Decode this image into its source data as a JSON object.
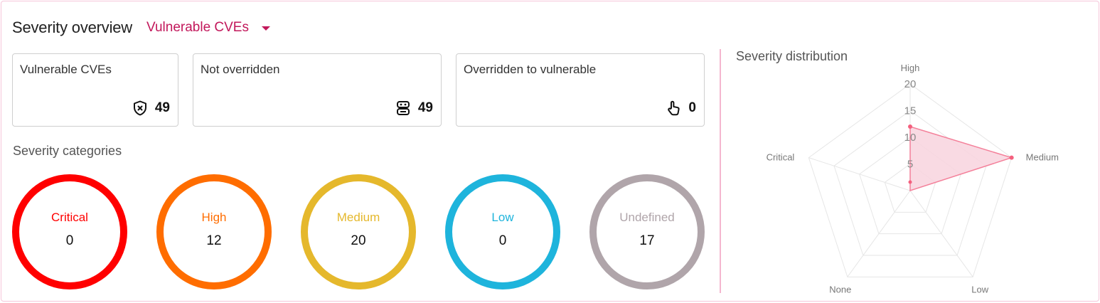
{
  "header": {
    "title": "Severity overview",
    "dropdown_value": "Vulnerable CVEs"
  },
  "cards": [
    {
      "title": "Vulnerable CVEs",
      "value": "49",
      "icon": "shield-x-icon"
    },
    {
      "title": "Not overridden",
      "value": "49",
      "icon": "robot-icon"
    },
    {
      "title": "Overridden to vulnerable",
      "value": "0",
      "icon": "hand-pointer-icon"
    }
  ],
  "categories": {
    "title": "Severity categories",
    "items": [
      {
        "label": "Critical",
        "value": "0",
        "color": "#ff0000"
      },
      {
        "label": "High",
        "value": "12",
        "color": "#ff6d00"
      },
      {
        "label": "Medium",
        "value": "20",
        "color": "#e5b82c"
      },
      {
        "label": "Low",
        "value": "0",
        "color": "#1eb4dc"
      },
      {
        "label": "Undefined",
        "value": "17",
        "color": "#b0a5aa"
      }
    ]
  },
  "distribution": {
    "title": "Severity distribution"
  },
  "chart_data": {
    "type": "radar",
    "axes": [
      "High",
      "Medium",
      "Low",
      "None",
      "Critical"
    ],
    "values": [
      12,
      20,
      0,
      0,
      0
    ],
    "ticks": [
      "5",
      "10",
      "15",
      "20"
    ],
    "rmax": 20,
    "fill_color": "#f8d3de",
    "line_color": "#f4809a",
    "grid_color": "#e6e6e6"
  }
}
